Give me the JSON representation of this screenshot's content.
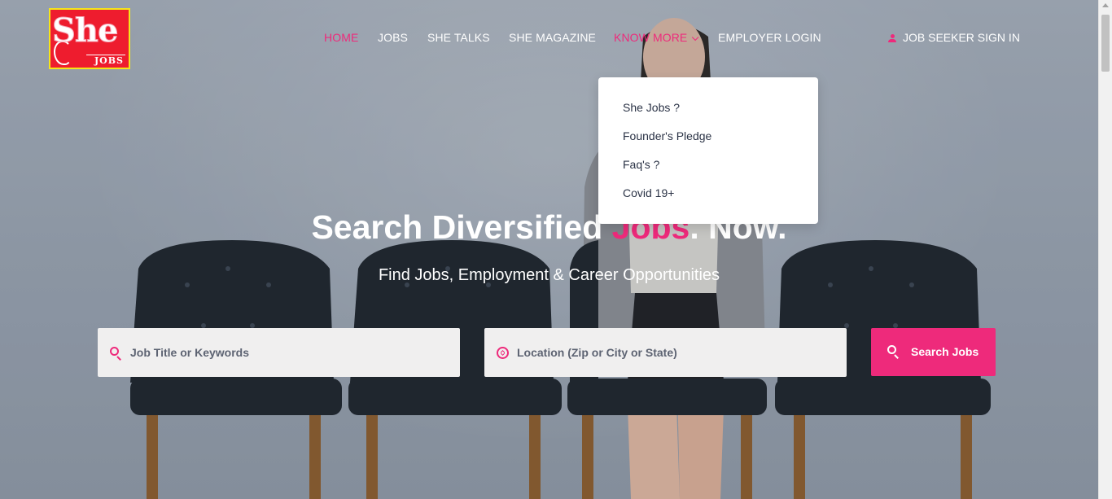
{
  "logo": {
    "she": "She",
    "jobs": "JOBS"
  },
  "nav": {
    "home": "HOME",
    "jobs": "JOBS",
    "she_talks": "SHE TALKS",
    "she_magazine": "SHE MAGAZINE",
    "know_more": "KNOW MORE",
    "employer_login": "EMPLOYER LOGIN",
    "job_seeker_sign_in": "JOB SEEKER SIGN IN"
  },
  "dropdown": {
    "items": [
      "She Jobs ?",
      "Founder's Pledge",
      "Faq's ?",
      "Covid 19+"
    ]
  },
  "hero": {
    "title_part1": "Search Diversified ",
    "title_highlight": "Jobs",
    "title_part2": ". Now.",
    "subtitle": "Find Jobs, Employment & Career Opportunities"
  },
  "search": {
    "keyword_placeholder": "Job Title or Keywords",
    "location_placeholder": "Location (Zip or City or State)",
    "button_label": "Search Jobs"
  },
  "colors": {
    "accent": "#ee2a7b",
    "logo_red": "#ee1c2e",
    "logo_border": "#f5e61a",
    "text_dark": "#2b3346"
  },
  "icons": [
    "search-icon",
    "compass-icon",
    "user-icon",
    "chevron-down-icon"
  ]
}
